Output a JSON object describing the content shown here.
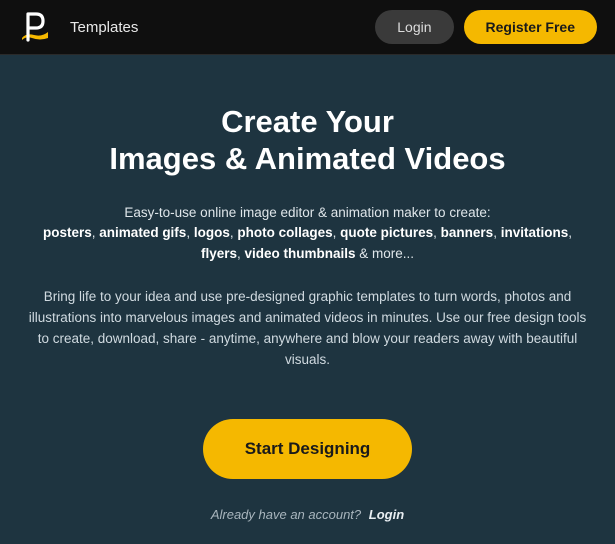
{
  "header": {
    "nav_templates": "Templates",
    "login_label": "Login",
    "register_label": "Register Free"
  },
  "hero": {
    "title_line1": "Create Your",
    "title_line2": "Images & Animated Videos",
    "sub_intro": "Easy-to-use online image editor & animation maker to create:",
    "keywords": [
      "posters",
      "animated gifs",
      "logos",
      "photo collages",
      "quote pictures",
      "banners",
      "invitations",
      "flyers",
      "video thumbnails"
    ],
    "keywords_tail": " & more...",
    "description": "Bring life to your idea and use pre-designed graphic templates to turn words, photos and illustrations into marvelous images and animated videos in minutes. Use our free design tools to create, download, share - anytime, anywhere and blow your readers away with beautiful visuals."
  },
  "cta": {
    "start_label": "Start Designing",
    "login_prompt": "Already have an account?",
    "login_link": "Login"
  },
  "colors": {
    "accent": "#f5b800",
    "bg": "#1e3440",
    "header_bg": "#0f0f0f"
  }
}
